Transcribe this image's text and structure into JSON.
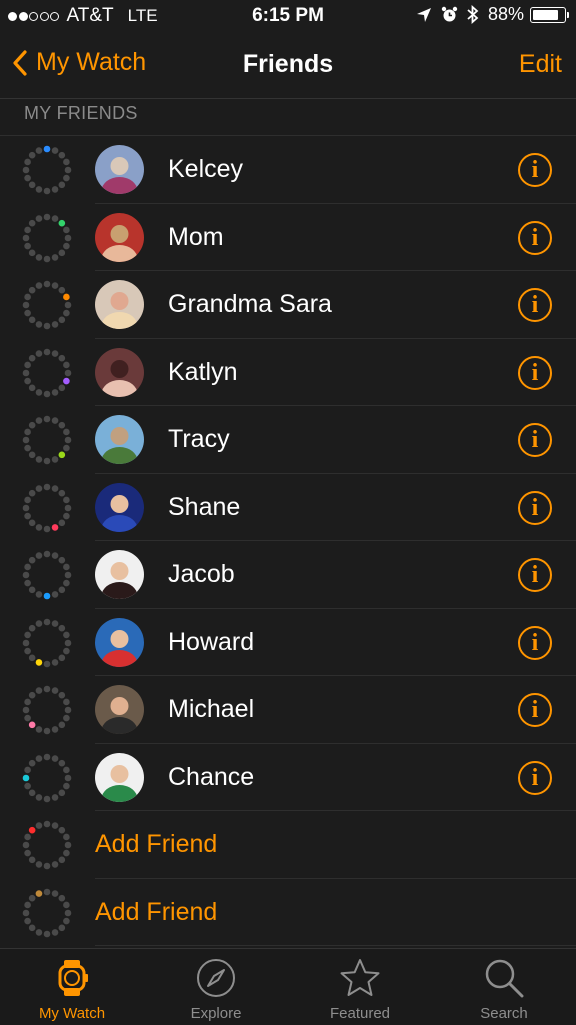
{
  "status_bar": {
    "signal_dots": 5,
    "signal_filled": 2,
    "carrier": "AT&T",
    "network": "LTE",
    "time": "6:15 PM",
    "battery_percent": "88%",
    "battery_level": 0.88,
    "icons": [
      "location-arrow-icon",
      "alarm-icon",
      "bluetooth-icon",
      "battery-icon"
    ]
  },
  "nav": {
    "back_label": "My Watch",
    "title": "Friends",
    "edit_label": "Edit"
  },
  "section": {
    "header": "MY FRIENDS"
  },
  "friends": [
    {
      "name": "Kelcey",
      "ring_color": "#2a8cff",
      "ring_dot": 0,
      "avatar_colors": [
        "#8aa0c8",
        "#a03a6a",
        "#d9c8b8"
      ]
    },
    {
      "name": "Mom",
      "ring_color": "#33d36b",
      "ring_dot": 2,
      "avatar_colors": [
        "#b8342c",
        "#e8b89a",
        "#c8a070"
      ]
    },
    {
      "name": "Grandma Sara",
      "ring_color": "#ff8a00",
      "ring_dot": 3,
      "avatar_colors": [
        "#d8c8b8",
        "#f0d8b0",
        "#e0a890"
      ]
    },
    {
      "name": "Katlyn",
      "ring_color": "#a45dff",
      "ring_dot": 5,
      "avatar_colors": [
        "#6a3a3a",
        "#e8c0b0",
        "#402020"
      ]
    },
    {
      "name": "Tracy",
      "ring_color": "#9ad81a",
      "ring_dot": 6,
      "avatar_colors": [
        "#7ab0d8",
        "#4a7a3a",
        "#c0a080"
      ]
    },
    {
      "name": "Shane",
      "ring_color": "#ff3b5c",
      "ring_dot": 7,
      "avatar_colors": [
        "#1a2a7a",
        "#2a4ab8",
        "#e8c0a0"
      ]
    },
    {
      "name": "Jacob",
      "ring_color": "#1a9cff",
      "ring_dot": 8,
      "avatar_colors": [
        "#f0f0f0",
        "#2a1a1a",
        "#e8c0a0"
      ]
    },
    {
      "name": "Howard",
      "ring_color": "#ffd60a",
      "ring_dot": 9,
      "avatar_colors": [
        "#2a6ab8",
        "#d83030",
        "#e8c0a0"
      ]
    },
    {
      "name": "Michael",
      "ring_color": "#ff7aa8",
      "ring_dot": 10,
      "avatar_colors": [
        "#6a5a4a",
        "#2a2a2a",
        "#e0b090"
      ]
    },
    {
      "name": "Chance",
      "ring_color": "#1ac8d8",
      "ring_dot": 12,
      "avatar_colors": [
        "#f0f0f0",
        "#2a8a4a",
        "#e8c0a0"
      ]
    }
  ],
  "add_rows": [
    {
      "label": "Add Friend",
      "ring_color": "#ff2d2d",
      "ring_dot": 14
    },
    {
      "label": "Add Friend",
      "ring_color": "#c08a3a",
      "ring_dot": 15
    }
  ],
  "tabs": [
    {
      "label": "My Watch",
      "icon": "watch-icon",
      "active": true
    },
    {
      "label": "Explore",
      "icon": "compass-icon",
      "active": false
    },
    {
      "label": "Featured",
      "icon": "star-icon",
      "active": false
    },
    {
      "label": "Search",
      "icon": "search-icon",
      "active": false
    }
  ],
  "colors": {
    "accent": "#ff9500",
    "background": "#1c1c1c",
    "separator": "#2e2e2e",
    "ring_dot": "#4a4a4a"
  }
}
